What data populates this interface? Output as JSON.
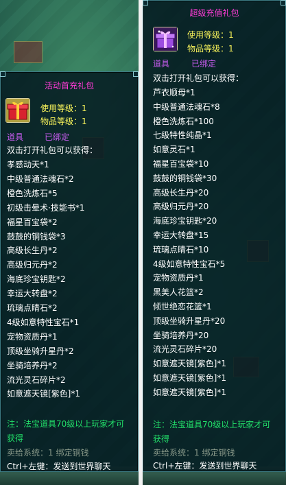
{
  "left_panel": {
    "title": "活动首充礼包",
    "level_label": "使用等级：1",
    "item_level_label": "物品等级：1",
    "tag_item": "道具",
    "tag_bound": "已绑定",
    "intro": "双击打开礼包可以获得：",
    "rewards": [
      "孝感动天*1",
      "中级普通法魂石*2",
      "橙色洗炼石*5",
      "初级击晕术·技能书*1",
      "福星百宝袋*2",
      "鼓鼓的铜钱袋*3",
      "高级长生丹*2",
      "高级归元丹*2",
      "海底珍宝钥匙*2",
      "幸运大转盘*2",
      "琉璃点睛石*2",
      "4级如意特性宝石*1",
      "宠物资质丹*1",
      "顶级坐骑升星丹*2",
      "坐骑培养丹*2",
      "流光灵石碎片*2",
      "如意遮天镜[紫色]*1"
    ],
    "note_line1": "注：法宝道具70级以上玩家才可",
    "note_line2": "获得",
    "sale_system": "卖给系统：1 绑定铜钱",
    "ctrl_hint": "Ctrl+左键：发送到世界聊天"
  },
  "right_panel": {
    "title": "超级充值礼包",
    "level_label": "使用等级：1",
    "item_level_label": "物品等级：1",
    "tag_item": "道具",
    "tag_bound": "已绑定",
    "intro": "双击打开礼包可以获得：",
    "rewards": [
      "芦衣顺母*1",
      "中级普通法魂石*8",
      "橙色洗炼石*100",
      "七级特性纯晶*1",
      "如意灵石*1",
      "福星百宝袋*10",
      "鼓鼓的铜钱袋*30",
      "高级长生丹*20",
      "高级归元丹*20",
      "海底珍宝钥匙*20",
      "幸运大转盘*15",
      "琉璃点睛石*10",
      "4级如意特性宝石*5",
      "宠物资质丹*1",
      "黑美人花篮*2",
      "倾世绝恋花篮*1",
      "顶级坐骑升星丹*20",
      "坐骑培养丹*20",
      "流光灵石碎片*20",
      "如意遮天镜[紫色]*1",
      "如意遮天镜[紫色]*1",
      "如意遮天镜[紫色]*1"
    ],
    "note_line1": "注：法宝道具70级以上玩家才可",
    "note_line2": "获得",
    "sale_system": "卖给系统：1 绑定铜钱",
    "ctrl_hint": "Ctrl+左键：发送到世界聊天"
  },
  "colors": {
    "title": "#ff3bd8",
    "level": "#f7f25a",
    "tag": "#c85cf0",
    "note": "#22e16a"
  },
  "icons": {
    "left_gift": "red-gift-box-icon",
    "right_gift": "purple-gift-box-icon"
  }
}
